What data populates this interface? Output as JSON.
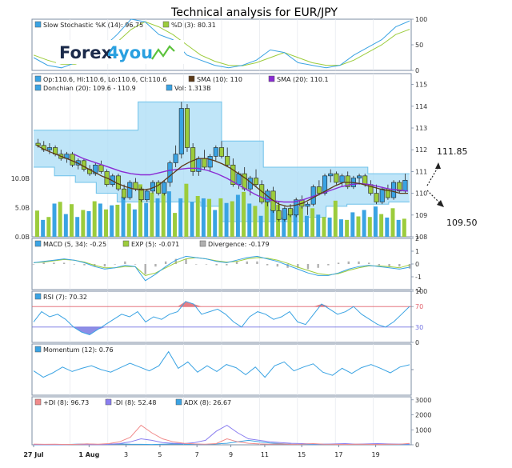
{
  "title": "Technical analysis for EUR/JPY",
  "logo": {
    "text_left": "Forex",
    "text_right": "you",
    "digit": "4"
  },
  "annotations": {
    "up": "111.85",
    "down": "109.50"
  },
  "colors": {
    "panel_border": "#7c8ca3",
    "grid": "#e4e8ee",
    "up_candle": "#3aa3e3",
    "down_candle": "#9ccc3c",
    "donchian_fill": "#aadcf5",
    "donchian_line": "#6fc2ea",
    "sma10": "#5c3a18",
    "sma20": "#8a2bd4",
    "volume_green": "#9ccc3c",
    "volume_blue": "#3aa3e3",
    "stoch_k": "#3aa3e3",
    "stoch_d": "#9ccc3c",
    "macd": "#3aa3e3",
    "exp": "#9ccc3c",
    "divergence": "#b0b0b0",
    "rsi": "#3aa3e3",
    "rsi_over": "#e0606a",
    "rsi_under": "#7070e0",
    "momentum": "#3aa3e3",
    "plus_di": "#f08a8a",
    "minus_di": "#8a7ef0",
    "adx": "#3aa3e3"
  },
  "x_labels": [
    {
      "label": "27 Jul",
      "i": 0,
      "bold": true
    },
    {
      "label": "1 Aug",
      "i": 18,
      "bold": true
    },
    {
      "label": "3",
      "i": 30,
      "bold": false
    },
    {
      "label": "5",
      "i": 41,
      "bold": false
    },
    {
      "label": "7",
      "i": 53,
      "bold": false
    },
    {
      "label": "9",
      "i": 64,
      "bold": false
    },
    {
      "label": "11",
      "i": 75,
      "bold": false
    },
    {
      "label": "15",
      "i": 87,
      "bold": false
    },
    {
      "label": "17",
      "i": 99,
      "bold": false
    },
    {
      "label": "19",
      "i": 111,
      "bold": false
    }
  ],
  "panels": {
    "stochastic": {
      "legend": [
        {
          "swatch": "#3aa3e3",
          "text": "Slow Stochastic %K (14): 96.75"
        },
        {
          "swatch": "#9ccc3c",
          "text": "%D (3): 80.31"
        }
      ],
      "ticks": [
        "100",
        "50",
        "0"
      ]
    },
    "price": {
      "legend_row1": [
        {
          "swatch": "#3aa3e3",
          "text": "Op:110.6, Hi:110.6, Lo:110.6, Cl:110.6"
        },
        {
          "swatch": "#5c3a18",
          "text": "SMA (10): 110"
        },
        {
          "swatch": "#8a2bd4",
          "text": "SMA (20): 110.1"
        }
      ],
      "legend_row2": [
        {
          "swatch": "#3aa3e3",
          "text": "Donchian (20): 109.6 - 110.9"
        },
        {
          "swatch": "#3aa3e3",
          "text": "Vol: 1.313B"
        }
      ],
      "ticks": [
        "115",
        "114",
        "113",
        "112",
        "111",
        "110",
        "109",
        "108"
      ],
      "volume_ticks": [
        "10.0B",
        "5.0B",
        "0.0B"
      ]
    },
    "macd": {
      "legend": [
        {
          "swatch": "#3aa3e3",
          "text": "MACD (5, 34): -0.25"
        },
        {
          "swatch": "#9ccc3c",
          "text": "EXP (5): -0.071"
        },
        {
          "swatch": "#b0b0b0",
          "text": "Divergence: -0.179"
        }
      ],
      "ticks": [
        "2",
        "1",
        "0",
        "-1",
        "-2"
      ]
    },
    "rsi": {
      "legend": [
        {
          "swatch": "#3aa3e3",
          "text": "RSI (7): 70.32"
        }
      ],
      "ticks": [
        "100",
        "70",
        "30",
        "0"
      ]
    },
    "momentum": {
      "legend": [
        {
          "swatch": "#3aa3e3",
          "text": "Momentum (12): 0.76"
        }
      ]
    },
    "dmi": {
      "legend": [
        {
          "swatch": "#f08a8a",
          "text": "+DI (8): 96.73"
        },
        {
          "swatch": "#8a7ef0",
          "text": "-DI (8): 52.48"
        },
        {
          "swatch": "#3aa3e3",
          "text": "ADX (8): 26.67"
        }
      ],
      "ticks": [
        "3000",
        "2000",
        "1000",
        "0"
      ]
    }
  },
  "chart_data": [
    {
      "type": "line",
      "name": "Slow Stochastic",
      "ylim": [
        0,
        100
      ],
      "series": [
        {
          "name": "Slow Stochastic %K (14)",
          "values": [
            25,
            10,
            5,
            15,
            30,
            45,
            70,
            100,
            95,
            70,
            60,
            30,
            20,
            10,
            5,
            10,
            20,
            40,
            35,
            15,
            10,
            5,
            10,
            30,
            45,
            60,
            85,
            96.75
          ]
        },
        {
          "name": "%D (3)",
          "values": [
            30,
            20,
            12,
            12,
            22,
            35,
            55,
            80,
            95,
            85,
            70,
            50,
            30,
            18,
            10,
            9,
            15,
            25,
            35,
            25,
            15,
            10,
            10,
            20,
            35,
            50,
            70,
            80.31
          ]
        }
      ]
    },
    {
      "type": "candlestick",
      "name": "EUR/JPY",
      "ylim": [
        108,
        115.5
      ],
      "ohlc": [
        [
          112.3,
          112.5,
          112.1,
          112.2
        ],
        [
          112.2,
          112.4,
          111.9,
          112.0
        ],
        [
          112.0,
          112.3,
          111.8,
          112.1
        ],
        [
          112.1,
          112.2,
          111.7,
          111.8
        ],
        [
          111.8,
          112.0,
          111.5,
          111.6
        ],
        [
          111.6,
          111.9,
          111.4,
          111.8
        ],
        [
          111.8,
          111.9,
          111.2,
          111.3
        ],
        [
          111.3,
          111.6,
          111.1,
          111.5
        ],
        [
          111.5,
          111.6,
          111.0,
          111.1
        ],
        [
          111.1,
          111.3,
          110.8,
          110.9
        ],
        [
          110.9,
          111.4,
          110.8,
          111.3
        ],
        [
          111.3,
          111.5,
          110.9,
          111.0
        ],
        [
          111.0,
          111.1,
          110.3,
          110.4
        ],
        [
          110.4,
          110.9,
          110.3,
          110.8
        ],
        [
          110.8,
          110.9,
          110.1,
          110.2
        ],
        [
          110.2,
          110.4,
          109.7,
          109.8
        ],
        [
          109.8,
          110.6,
          109.7,
          110.5
        ],
        [
          110.5,
          110.7,
          110.1,
          110.2
        ],
        [
          110.2,
          110.3,
          109.6,
          109.7
        ],
        [
          109.7,
          110.2,
          109.6,
          110.1
        ],
        [
          110.1,
          110.6,
          110.0,
          110.5
        ],
        [
          110.5,
          110.6,
          109.9,
          110.0
        ],
        [
          110.0,
          110.6,
          109.9,
          110.5
        ],
        [
          110.5,
          111.5,
          110.3,
          111.4
        ],
        [
          111.4,
          112.2,
          111.2,
          111.8
        ],
        [
          111.8,
          114.2,
          111.6,
          113.9
        ],
        [
          113.9,
          114.1,
          111.9,
          112.1
        ],
        [
          112.1,
          112.3,
          110.8,
          111.0
        ],
        [
          111.0,
          111.7,
          110.8,
          111.6
        ],
        [
          111.6,
          112.0,
          111.1,
          111.2
        ],
        [
          111.2,
          111.8,
          111.0,
          111.7
        ],
        [
          111.7,
          112.2,
          111.5,
          112.1
        ],
        [
          112.1,
          112.4,
          111.6,
          111.7
        ],
        [
          111.7,
          112.1,
          111.2,
          111.3
        ],
        [
          111.3,
          111.6,
          110.3,
          110.4
        ],
        [
          110.4,
          111.0,
          110.2,
          110.9
        ],
        [
          110.9,
          111.2,
          110.1,
          110.2
        ],
        [
          110.2,
          110.8,
          109.9,
          110.7
        ],
        [
          110.7,
          111.1,
          110.3,
          110.4
        ],
        [
          110.4,
          110.6,
          109.5,
          109.6
        ],
        [
          109.6,
          110.2,
          109.4,
          110.1
        ],
        [
          110.1,
          110.3,
          109.1,
          109.2
        ],
        [
          109.2,
          109.6,
          108.7,
          108.8
        ],
        [
          108.8,
          109.4,
          108.7,
          109.3
        ],
        [
          109.3,
          109.5,
          108.9,
          109.0
        ],
        [
          109.0,
          109.8,
          108.9,
          109.7
        ],
        [
          109.7,
          109.9,
          109.3,
          109.4
        ],
        [
          109.4,
          109.6,
          109.0,
          109.5
        ],
        [
          109.5,
          110.4,
          109.4,
          110.3
        ],
        [
          110.3,
          110.6,
          109.9,
          110.0
        ],
        [
          110.0,
          110.9,
          109.9,
          110.8
        ],
        [
          110.8,
          111.1,
          110.5,
          110.9
        ],
        [
          110.9,
          111.0,
          110.4,
          110.5
        ],
        [
          110.5,
          110.9,
          110.3,
          110.8
        ],
        [
          110.8,
          111.0,
          110.2,
          110.3
        ],
        [
          110.3,
          110.8,
          110.2,
          110.7
        ],
        [
          110.7,
          110.9,
          110.4,
          110.8
        ],
        [
          110.8,
          110.9,
          110.3,
          110.4
        ],
        [
          110.4,
          110.6,
          109.9,
          110.0
        ],
        [
          110.0,
          110.4,
          109.5,
          109.6
        ],
        [
          109.6,
          110.3,
          109.5,
          110.2
        ],
        [
          110.2,
          110.4,
          109.7,
          109.8
        ],
        [
          109.8,
          110.6,
          109.7,
          110.5
        ],
        [
          110.5,
          110.6,
          110.0,
          110.1
        ],
        [
          110.1,
          110.9,
          110.0,
          110.6
        ]
      ],
      "series": [
        {
          "name": "SMA (10)",
          "values": [
            112.2,
            112.0,
            111.85,
            111.7,
            111.55,
            111.4,
            111.2,
            111.0,
            110.8,
            110.65,
            110.45,
            110.3,
            110.2,
            110.15,
            110.2,
            110.35,
            110.65,
            110.95,
            111.25,
            111.45,
            111.6,
            111.6,
            111.5,
            111.35,
            111.15,
            110.9,
            110.65,
            110.35,
            110.05,
            109.75,
            109.5,
            109.4,
            109.45,
            109.55,
            109.75,
            109.95,
            110.15,
            110.35,
            110.5,
            110.5,
            110.45,
            110.35,
            110.25,
            110.15,
            110.1,
            110.0,
            110.0
          ]
        },
        {
          "name": "SMA (20)",
          "values": [
            111.8,
            111.6,
            111.45,
            111.3,
            111.15,
            111.0,
            110.9,
            110.85,
            110.85,
            110.95,
            111.05,
            111.1,
            111.15,
            111.15,
            111.05,
            110.9,
            110.7,
            110.45,
            110.2,
            109.95,
            109.75,
            109.65,
            109.6,
            109.6,
            109.7,
            109.85,
            110.0,
            110.15,
            110.3,
            110.4,
            110.45,
            110.4,
            110.3,
            110.2,
            110.15,
            110.1
          ]
        }
      ],
      "donchian": {
        "upper": [
          112.9,
          112.9,
          112.9,
          112.9,
          112.9,
          114.2,
          114.2,
          114.2,
          114.2,
          112.4,
          112.4,
          111.2,
          111.2,
          111.2,
          111.2,
          111.2,
          110.9,
          110.9
        ],
        "lower": [
          111.2,
          110.8,
          110.5,
          110.0,
          109.6,
          109.6,
          109.6,
          109.6,
          109.4,
          108.7,
          108.7,
          108.7,
          108.7,
          108.9,
          109.4,
          109.5,
          109.5,
          109.6
        ]
      },
      "volume": [
        4.5,
        2.9,
        3.4,
        5.7,
        6.0,
        3.9,
        5.6,
        3.4,
        4.6,
        4.4,
        6.1,
        5.7,
        4.7,
        5.4,
        5.5,
        6.9,
        5.7,
        4.7,
        9.0,
        5.8,
        7.6,
        6.6,
        7.4,
        7.8,
        4.1,
        6.6,
        9.1,
        6.0,
        7.0,
        6.6,
        6.5,
        4.6,
        6.6,
        5.8,
        6.1,
        7.2,
        7.7,
        5.7,
        5.3,
        3.6,
        6.7,
        4.8,
        5.5,
        3.3,
        4.0,
        4.8,
        5.1,
        3.6,
        4.9,
        3.8,
        3.4,
        3.3,
        6.2,
        3.0,
        2.9,
        4.2,
        3.5,
        4.6,
        3.4,
        5.2,
        3.9,
        3.3,
        4.9,
        2.9,
        3.1
      ]
    },
    {
      "type": "line",
      "name": "MACD",
      "ylim": [
        -2,
        2
      ],
      "series": [
        {
          "name": "MACD (5, 34)",
          "values": [
            0.1,
            0.2,
            0.3,
            0.4,
            0.3,
            0.1,
            -0.2,
            -0.4,
            -0.3,
            -0.1,
            -0.2,
            -1.3,
            -0.8,
            -0.2,
            0.3,
            0.6,
            0.5,
            0.4,
            0.2,
            0.1,
            0.3,
            0.5,
            0.6,
            0.4,
            0.2,
            -0.1,
            -0.4,
            -0.7,
            -0.9,
            -0.9,
            -0.7,
            -0.4,
            -0.2,
            -0.1,
            -0.2,
            -0.3,
            -0.4,
            -0.25
          ]
        },
        {
          "name": "EXP (5)",
          "values": [
            0.1,
            0.15,
            0.25,
            0.35,
            0.3,
            0.15,
            -0.1,
            -0.3,
            -0.3,
            -0.2,
            -0.2,
            -0.9,
            -0.7,
            -0.3,
            0.1,
            0.4,
            0.5,
            0.4,
            0.25,
            0.15,
            0.2,
            0.4,
            0.5,
            0.45,
            0.3,
            0.05,
            -0.25,
            -0.5,
            -0.75,
            -0.85,
            -0.75,
            -0.5,
            -0.3,
            -0.15,
            -0.15,
            -0.2,
            -0.3,
            -0.071
          ]
        }
      ]
    },
    {
      "type": "line",
      "name": "RSI",
      "ylim": [
        0,
        100
      ],
      "series": [
        {
          "name": "RSI (7)",
          "values": [
            40,
            60,
            50,
            55,
            45,
            30,
            20,
            15,
            25,
            35,
            45,
            55,
            50,
            60,
            40,
            50,
            45,
            55,
            60,
            80,
            75,
            55,
            60,
            65,
            55,
            40,
            30,
            50,
            60,
            55,
            45,
            50,
            60,
            40,
            35,
            55,
            75,
            65,
            55,
            60,
            70,
            55,
            45,
            35,
            30,
            40,
            55,
            70.32
          ]
        }
      ]
    },
    {
      "type": "line",
      "name": "Momentum",
      "ylim": [
        -4,
        4
      ],
      "series": [
        {
          "name": "Momentum (12)",
          "values": [
            -0.2,
            -1.2,
            -0.5,
            0.4,
            -0.3,
            0.2,
            0.6,
            0.0,
            -0.4,
            0.3,
            1.0,
            0.4,
            -0.2,
            0.6,
            2.8,
            0.2,
            1.2,
            -0.4,
            0.6,
            -0.3,
            0.8,
            0.3,
            -0.8,
            0.4,
            -1.2,
            0.6,
            1.2,
            -0.2,
            0.4,
            0.9,
            -0.4,
            -0.9,
            0.2,
            -0.6,
            0.3,
            0.8,
            0.2,
            -0.5,
            0.4,
            0.76
          ]
        }
      ]
    },
    {
      "type": "line",
      "name": "DMI",
      "ylim": [
        0,
        3200
      ],
      "series": [
        {
          "name": "+DI (8)",
          "values": [
            50,
            30,
            40,
            20,
            30,
            60,
            40,
            80,
            200,
            500,
            1300,
            800,
            400,
            200,
            100,
            60,
            40,
            80,
            400,
            200,
            100,
            60,
            40,
            60,
            30,
            40,
            80,
            40,
            30,
            20,
            40,
            30,
            20,
            40,
            30,
            96.73
          ]
        },
        {
          "name": "-DI (8)",
          "values": [
            20,
            10,
            20,
            10,
            30,
            20,
            10,
            40,
            80,
            200,
            400,
            300,
            150,
            100,
            80,
            150,
            300,
            900,
            1300,
            800,
            400,
            300,
            200,
            150,
            100,
            80,
            60,
            40,
            60,
            80,
            40,
            60,
            80,
            60,
            50,
            52.48
          ]
        },
        {
          "name": "ADX (8)",
          "values": [
            0,
            10,
            0,
            20,
            40,
            60,
            20,
            30,
            60,
            40,
            30,
            20,
            40,
            60,
            40,
            30,
            20,
            60,
            100,
            200,
            300,
            200,
            120,
            80,
            40,
            30,
            20,
            40,
            30,
            20,
            30,
            40,
            30,
            20,
            10,
            26.67
          ]
        }
      ]
    }
  ]
}
